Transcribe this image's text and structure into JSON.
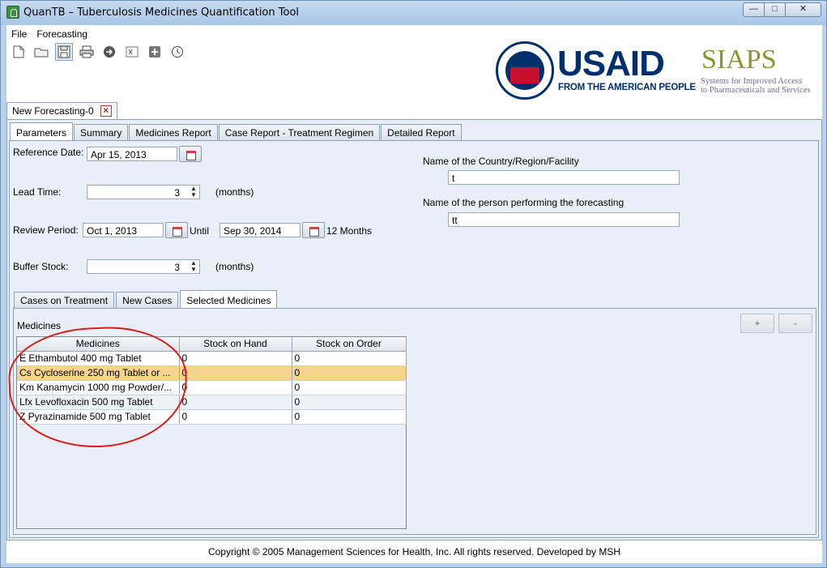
{
  "window": {
    "title": "QuanTB – Tuberculosis Medicines Quantification Tool",
    "controls": {
      "minimize": "—",
      "maximize": "□",
      "close": "✕"
    }
  },
  "menubar": {
    "items": [
      "File",
      "Forecasting"
    ]
  },
  "toolbar": {
    "icons": [
      "new-file-icon",
      "open-folder-icon",
      "save-icon",
      "print-icon",
      "arrow-right-icon",
      "export-excel-icon",
      "add-icon",
      "clock-icon"
    ]
  },
  "logos": {
    "seal_text": "USAID",
    "usaid_main": "USAID",
    "usaid_tagline": "FROM THE AMERICAN PEOPLE",
    "siaps_main": "SIAPS",
    "siaps_tagline_1": "Systems for Improved Access",
    "siaps_tagline_2": "to Pharmaceuticals and Services"
  },
  "document_tab": {
    "label": "New Forecasting-0",
    "close": "×"
  },
  "tabs": [
    "Parameters",
    "Summary",
    "Medicines Report",
    "Case Report - Treatment Regimen",
    "Detailed Report"
  ],
  "params": {
    "reference_date_label": "Reference Date:",
    "reference_date": "Apr 15, 2013",
    "lead_time_label": "Lead Time:",
    "lead_time": "3",
    "lead_time_unit": "(months)",
    "review_period_label": "Review Period:",
    "review_start": "Oct 1, 2013",
    "until_label": "Until",
    "review_end": "Sep 30, 2014",
    "review_months": "12 Months",
    "buffer_stock_label": "Buffer Stock:",
    "buffer_stock": "3",
    "buffer_stock_unit": "(months)",
    "country_label": "Name of the Country/Region/Facility",
    "country_value": "t",
    "person_label": "Name of the person performing the forecasting",
    "person_value": "tt"
  },
  "subtabs": [
    "Cases on Treatment",
    "New Cases",
    "Selected Medicines"
  ],
  "medicines": {
    "section_label": "Medicines",
    "add_button": "+",
    "remove_button": "-",
    "columns": [
      "Medicines",
      "Stock on Hand",
      "Stock on Order"
    ],
    "rows": [
      {
        "name": "E  Ethambutol  400 mg  Tablet",
        "on_hand": "0",
        "on_order": "0"
      },
      {
        "name": "Cs  Cycloserine  250 mg  Tablet or ...",
        "on_hand": "0",
        "on_order": "0"
      },
      {
        "name": "Km  Kanamycin  1000 mg  Powder/...",
        "on_hand": "0",
        "on_order": "0"
      },
      {
        "name": "Lfx  Levofloxacin  500 mg  Tablet",
        "on_hand": "0",
        "on_order": "0"
      },
      {
        "name": "Z  Pyrazinamide  500 mg  Tablet",
        "on_hand": "0",
        "on_order": "0"
      }
    ]
  },
  "footer": {
    "copyright": "Copyright © 2005 Management Sciences for Health, Inc. All rights reserved. Developed by MSH"
  },
  "colors": {
    "highlight_row": "#f6d48f",
    "annotation": "#d81e1e",
    "usaid_blue": "#002f6c",
    "usaid_red": "#c8102e"
  }
}
